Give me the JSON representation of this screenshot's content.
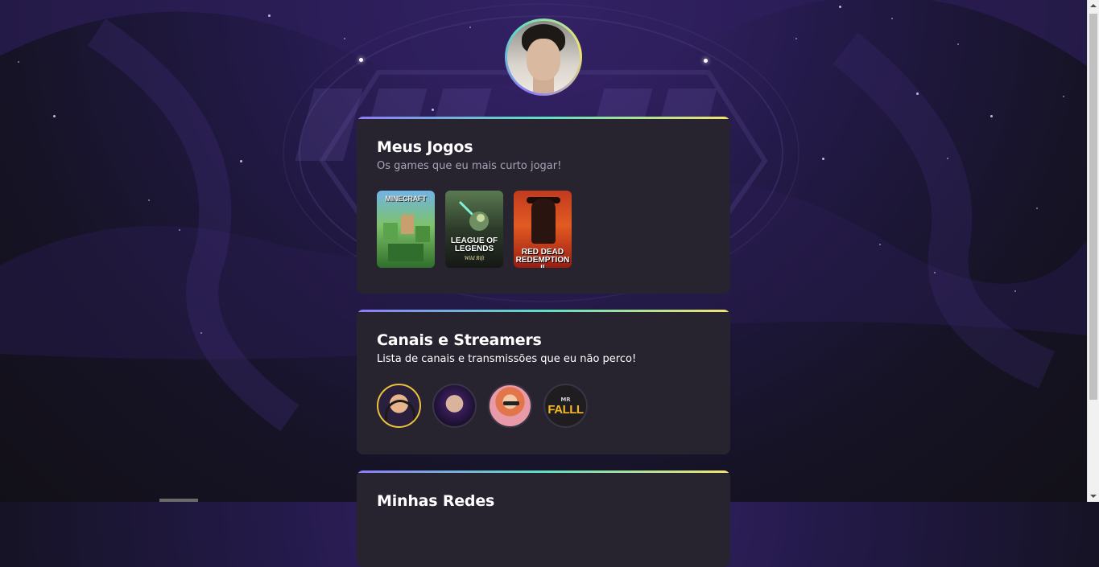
{
  "profile": {
    "avatar_alt": "profile photo"
  },
  "games_section": {
    "title": "Meus Jogos",
    "subtitle": "Os games que eu mais curto jogar!",
    "games": [
      {
        "name": "MINECRAFT",
        "icon": "minecraft-cover"
      },
      {
        "name": "LEAGUE OF LEGENDS",
        "subtitle": "Wild Rift",
        "icon": "wild-rift-cover"
      },
      {
        "name": "RED DEAD REDEMPTION II",
        "icon": "rdr2-cover"
      }
    ]
  },
  "streamers_section": {
    "title": "Canais e Streamers",
    "subtitle": "Lista de canais e transmissões que eu não perco!",
    "streamers": [
      {
        "icon": "streamer-1-avatar"
      },
      {
        "icon": "streamer-2-avatar"
      },
      {
        "icon": "streamer-3-avatar"
      },
      {
        "icon": "mr-falll-avatar",
        "logo_top": "MR",
        "logo_main": "FALLL"
      }
    ]
  },
  "social_section": {
    "title": "Minhas Redes"
  },
  "colors": {
    "gradient_start": "#8b7cf8",
    "gradient_mid": "#5ee0c2",
    "gradient_end": "#f2e36d",
    "card_bg": "#27232f"
  }
}
